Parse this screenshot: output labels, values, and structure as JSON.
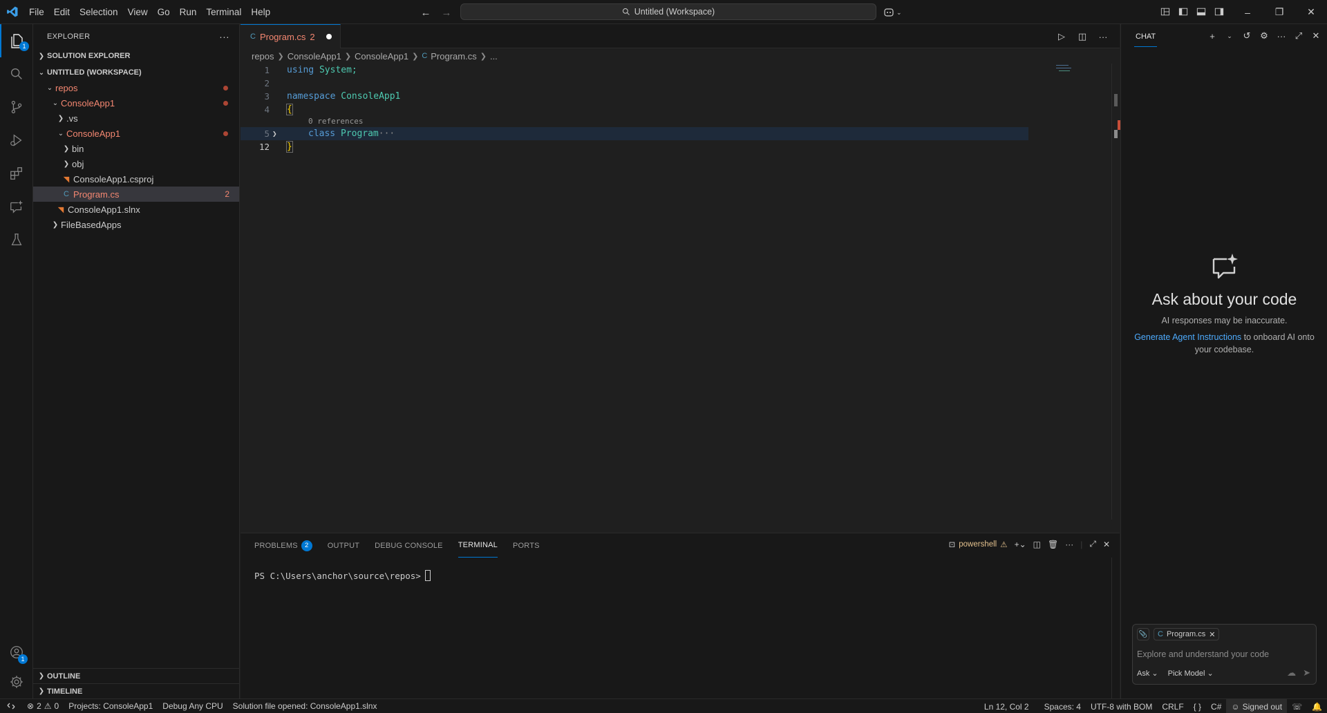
{
  "titlebar": {
    "menu": [
      "File",
      "Edit",
      "Selection",
      "View",
      "Go",
      "Run",
      "Terminal",
      "Help"
    ],
    "search_text": "Untitled (Workspace)"
  },
  "activity": {
    "explorer_badge": "1",
    "accounts_badge": "1"
  },
  "sidebar": {
    "title": "EXPLORER",
    "solution_explorer": "SOLUTION EXPLORER",
    "workspace": "UNTITLED (WORKSPACE)",
    "tree": {
      "repos": "repos",
      "consoleapp1_root": "ConsoleApp1",
      "vs": ".vs",
      "consoleapp1_proj": "ConsoleApp1",
      "bin": "bin",
      "obj": "obj",
      "csproj": "ConsoleApp1.csproj",
      "program": "Program.cs",
      "program_errors": "2",
      "slnx": "ConsoleApp1.slnx",
      "filebased": "FileBasedApps"
    },
    "outline": "OUTLINE",
    "timeline": "TIMELINE"
  },
  "editor": {
    "tab_label": "Program.cs",
    "tab_errors": "2",
    "breadcrumb": [
      "repos",
      "ConsoleApp1",
      "ConsoleApp1",
      "Program.cs",
      "..."
    ],
    "lines": {
      "n1": "1",
      "n2": "2",
      "n3": "3",
      "n4": "4",
      "n5": "5",
      "n12": "12",
      "using_kw": "using",
      "using_ns": "System;",
      "namespace_kw": "namespace",
      "namespace_name": "ConsoleApp1",
      "open_brace": "{",
      "codelens": "0 references",
      "class_kw": "class",
      "class_name": "Program",
      "fold": "···",
      "close_brace": "}"
    }
  },
  "panel": {
    "tabs": {
      "problems": "PROBLEMS",
      "problems_count": "2",
      "output": "OUTPUT",
      "debug_console": "DEBUG CONSOLE",
      "terminal": "TERMINAL",
      "ports": "PORTS"
    },
    "shell": "powershell",
    "prompt": "PS C:\\Users\\anchor\\source\\repos>"
  },
  "chat": {
    "title": "CHAT",
    "heading": "Ask about your code",
    "disclaimer": "AI responses may be inaccurate.",
    "link": "Generate Agent Instructions",
    "link_suffix": "to onboard AI onto your codebase.",
    "context_chip": "Program.cs",
    "placeholder": "Explore and understand your code",
    "mode": "Ask",
    "model": "Pick Model"
  },
  "status": {
    "errors": "2",
    "warnings": "0",
    "projects": "Projects: ConsoleApp1",
    "config": "Debug Any CPU",
    "message": "Solution file opened: ConsoleApp1.slnx",
    "position": "Ln 12, Col 2",
    "spaces": "Spaces: 4",
    "encoding": "UTF-8 with BOM",
    "eol": "CRLF",
    "braces": "{ }",
    "language": "C#",
    "signed": "Signed out"
  },
  "colors": {
    "accent": "#0078d4",
    "modified": "#f48771",
    "link": "#4daafc",
    "keyword": "#569cd6",
    "type": "#4ec9b0"
  }
}
